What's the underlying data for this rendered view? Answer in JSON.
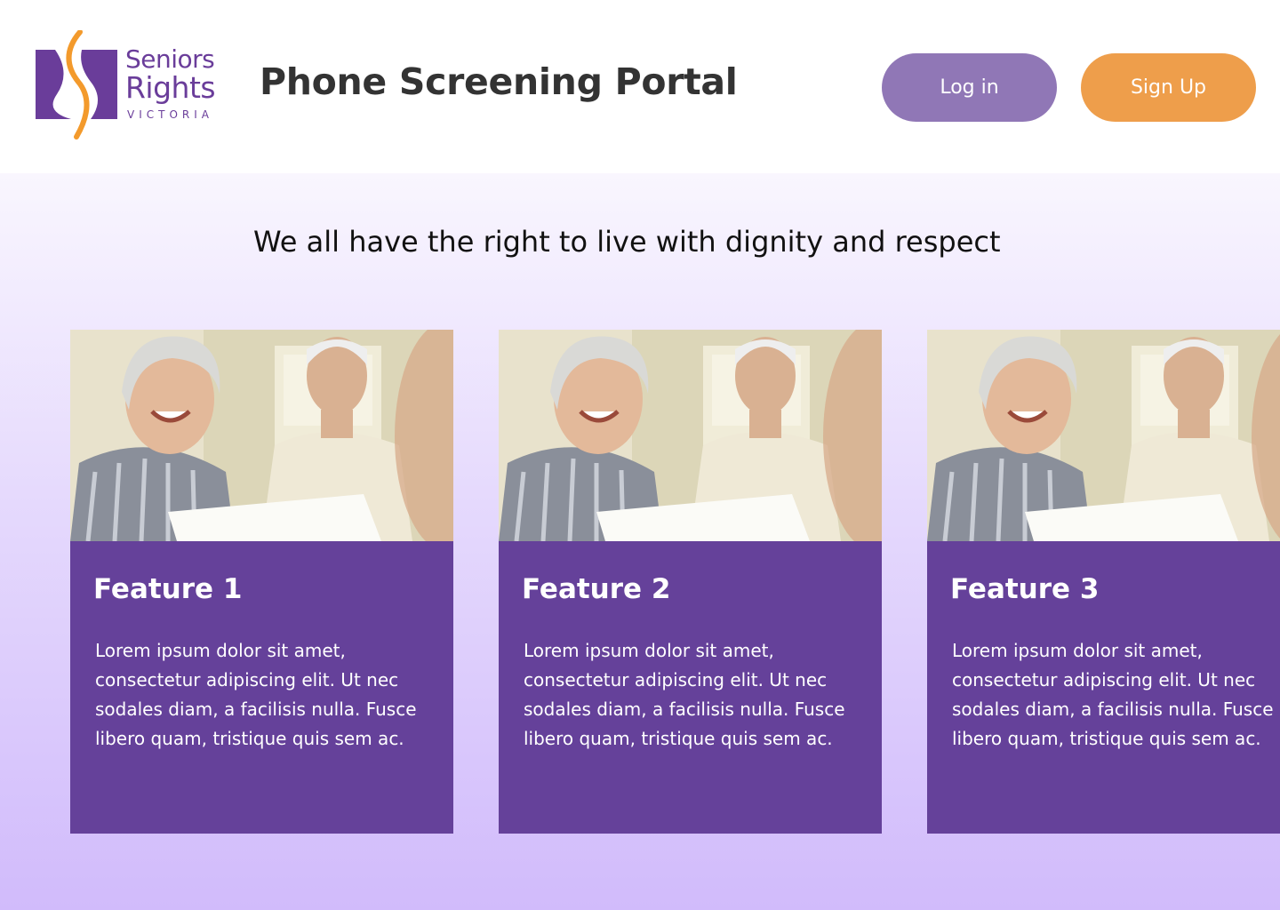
{
  "header": {
    "logo": {
      "line1": "Seniors",
      "line2": "Rights",
      "line3": "VICTORIA",
      "brand_purple": "#6a3d9a",
      "brand_orange": "#f39a2c"
    },
    "title": "Phone Screening Portal",
    "login_label": "Log in",
    "signup_label": "Sign Up"
  },
  "main": {
    "tagline": "We all have the right to live with dignity and respect",
    "cards": [
      {
        "title": "Feature 1",
        "text": "Lorem ipsum dolor sit amet, consectetur adipiscing elit. Ut nec sodales diam, a facilisis nulla. Fusce libero quam, tristique quis sem ac."
      },
      {
        "title": "Feature 2",
        "text": "Lorem ipsum dolor sit amet, consectetur adipiscing elit. Ut nec sodales diam, a facilisis nulla. Fusce libero quam, tristique quis sem ac."
      },
      {
        "title": "Feature 3",
        "text": "Lorem ipsum dolor sit amet, consectetur adipiscing elit. Ut nec sodales diam, a facilisis nulla. Fusce libero quam, tristique quis sem ac."
      }
    ]
  },
  "colors": {
    "login_button": "#9077b6",
    "signup_button": "#ee9e4b",
    "card_background": "#65419a",
    "title_text": "#333333"
  }
}
